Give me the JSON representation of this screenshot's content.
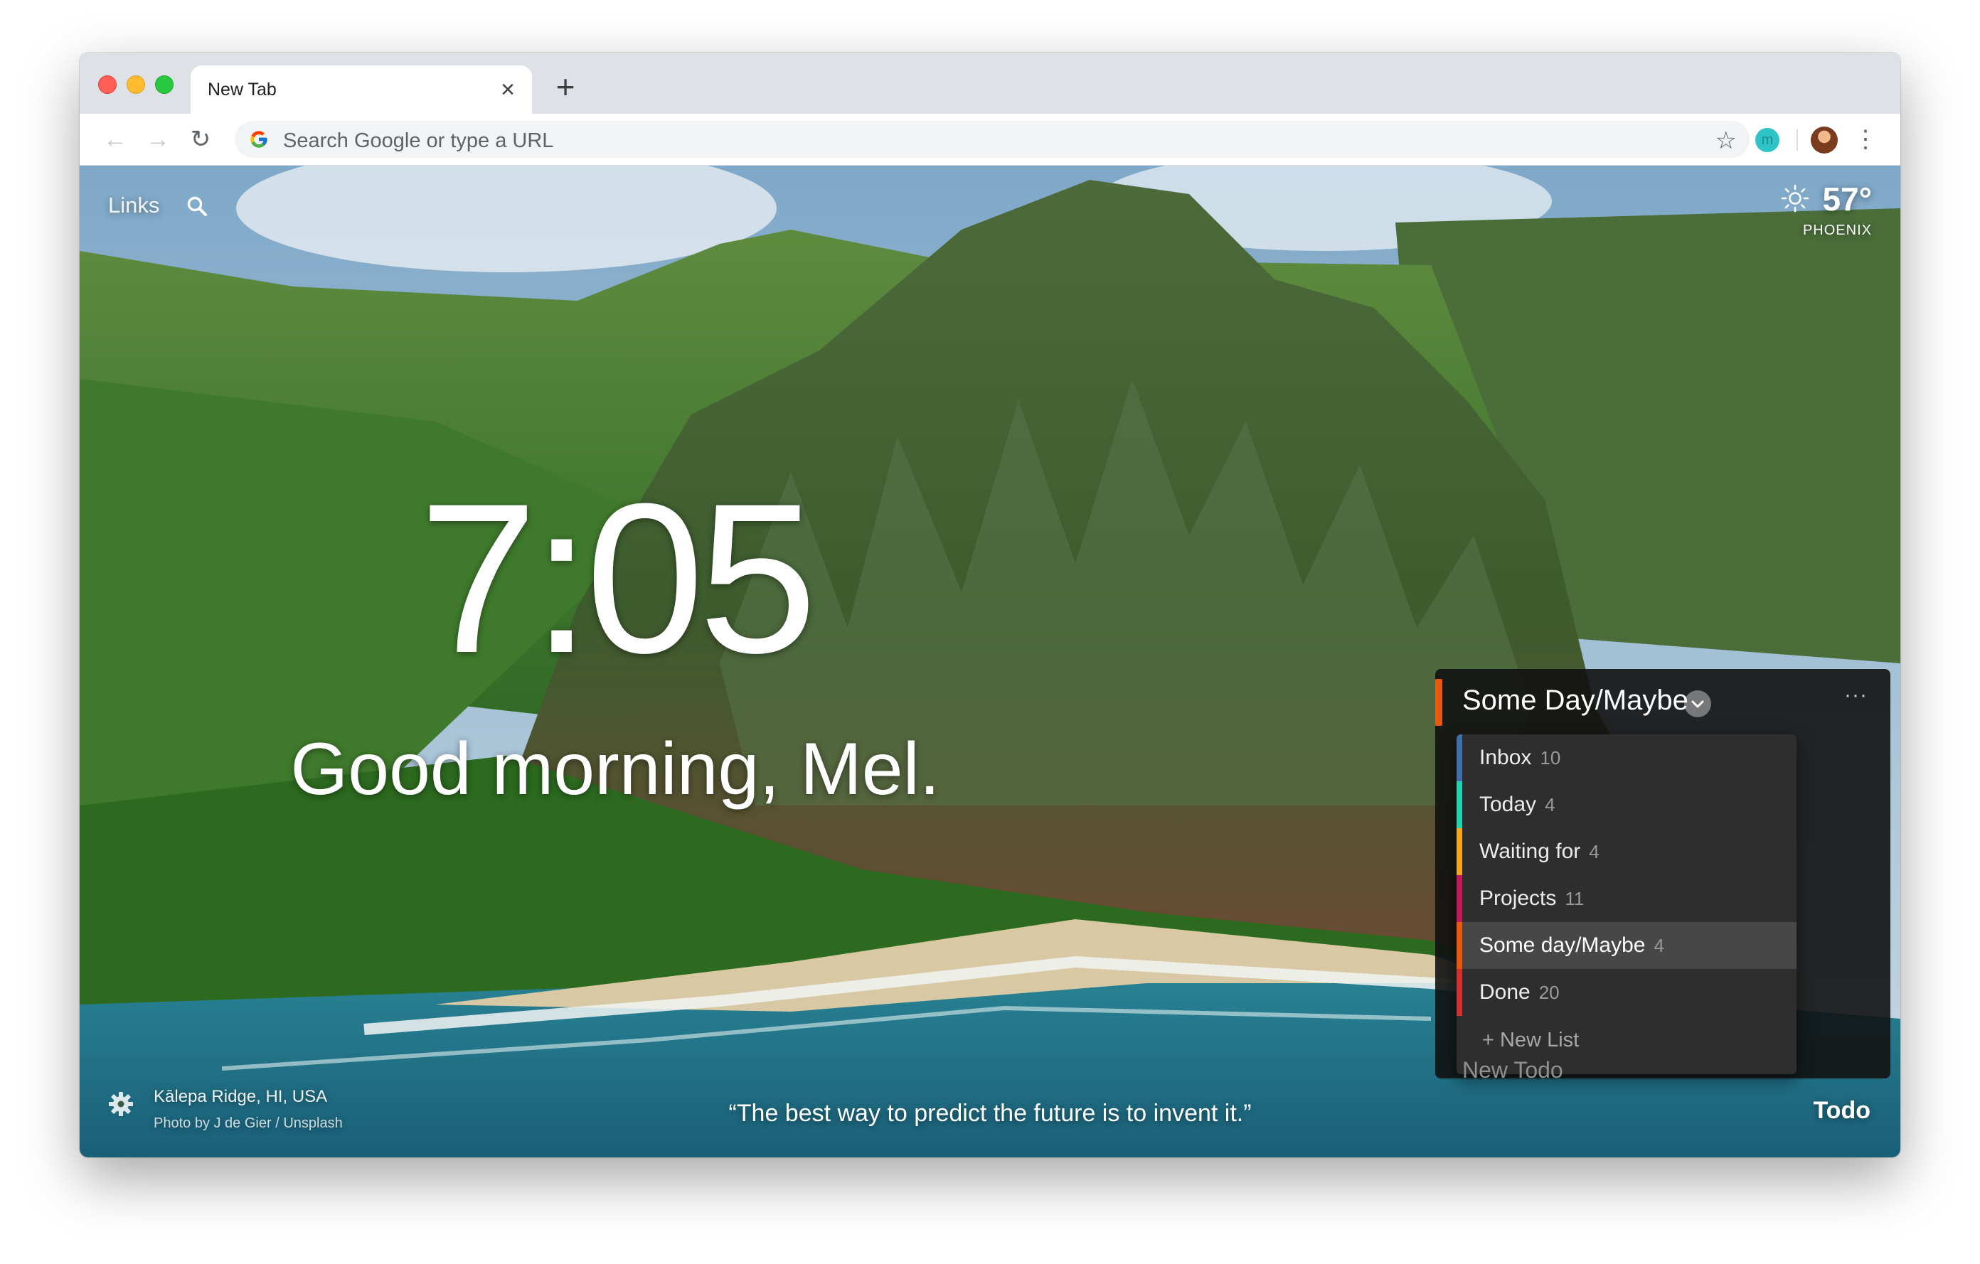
{
  "browser": {
    "tab": {
      "title": "New Tab",
      "close_icon": "×"
    },
    "new_tab_icon": "+",
    "nav": {
      "back_icon": "←",
      "forward_icon": "→",
      "reload_icon": "↻"
    },
    "omnibox": {
      "placeholder": "Search Google or type a URL"
    },
    "bookmark_icon": "☆",
    "extension_letter": "m",
    "menu_icon": "⋮"
  },
  "dashboard": {
    "links_label": "Links",
    "weather": {
      "temperature": "57°",
      "city": "PHOENIX",
      "condition": "sunny"
    },
    "clock": "7:05",
    "greeting": "Good morning, Mel.",
    "photo": {
      "location": "Kālepa Ridge, HI, USA",
      "credit": "Photo by J de Gier / Unsplash"
    },
    "quote": "“The best way to predict the future is to invent it.”",
    "todo_link": "Todo"
  },
  "todo": {
    "current_list": "Some Day/Maybe",
    "more_icon": "···",
    "lists": [
      {
        "label": "Inbox",
        "count": "10",
        "color": "#3f6ea8",
        "active": false
      },
      {
        "label": "Today",
        "count": "4",
        "color": "#1fd6b0",
        "active": false
      },
      {
        "label": "Waiting for",
        "count": "4",
        "color": "#f2a81d",
        "active": false
      },
      {
        "label": "Projects",
        "count": "11",
        "color": "#c2185b",
        "active": false
      },
      {
        "label": "Some day/Maybe",
        "count": "4",
        "color": "#e8590c",
        "active": true
      },
      {
        "label": "Done",
        "count": "20",
        "color": "#d32f2f",
        "active": false
      }
    ],
    "new_list_label": "+ New List",
    "new_todo_placeholder": "New Todo"
  },
  "colors": {
    "accent": "#e8590c",
    "ext_badge": "#2ec4c7"
  }
}
